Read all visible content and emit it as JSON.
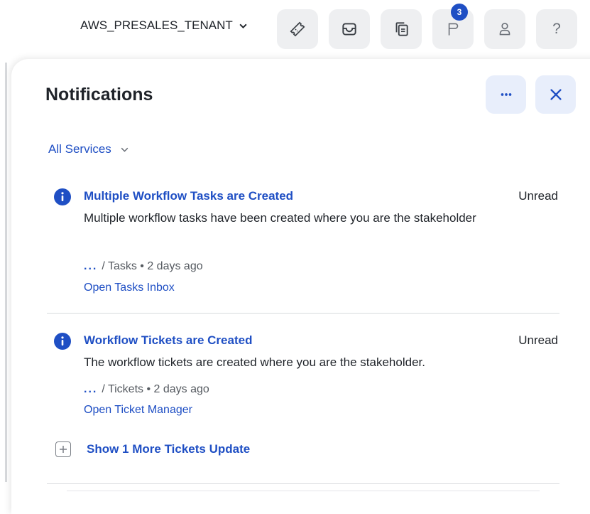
{
  "header": {
    "tenant": "AWS_PRESALES_TENANT",
    "badge_count": "3",
    "icons": [
      "ticket-icon",
      "inbox-icon",
      "copy-list-icon",
      "flag-icon",
      "user-icon",
      "help-icon"
    ],
    "help_glyph": "?"
  },
  "panel": {
    "title": "Notifications",
    "filter": "All Services",
    "notifications": [
      {
        "title": "Multiple Workflow Tasks are Created",
        "status": "Unread",
        "body": "Multiple workflow tasks have been created where you are the stakeholder",
        "path_dots": "...",
        "path": "/ Tasks • 2 days ago",
        "link": "Open Tasks Inbox"
      },
      {
        "title": "Workflow Tickets are Created",
        "status": "Unread",
        "body": "The workflow tickets are created where you are the stakeholder.",
        "path_dots": "...",
        "path": "/ Tickets • 2 days ago",
        "link": "Open Ticket Manager"
      }
    ],
    "show_more": "Show 1 More Tickets Update"
  },
  "colors": {
    "accent": "#1f4fc4",
    "button_bg": "#eeeff1",
    "panel_button_bg": "#e8eefb"
  }
}
